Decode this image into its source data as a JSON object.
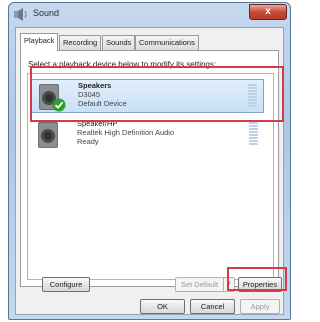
{
  "window": {
    "title": "Sound",
    "close_label": "x"
  },
  "tabs": [
    {
      "label": "Playback",
      "active": true
    },
    {
      "label": "Recording",
      "active": false
    },
    {
      "label": "Sounds",
      "active": false
    },
    {
      "label": "Communications",
      "active": false
    }
  ],
  "panel": {
    "instruction": "Select a playback device below to modify its settings:"
  },
  "devices": [
    {
      "name": "Speakers",
      "description": "D3045",
      "status": "Default Device",
      "selected": true,
      "default": true,
      "icon": "speaker-icon"
    },
    {
      "name": "Speaker/HP",
      "description": "Realtek High Definition Audio",
      "status": "Ready",
      "selected": false,
      "default": false,
      "icon": "speaker-icon"
    }
  ],
  "buttons": {
    "configure": "Configure",
    "set_default": "Set Default",
    "properties": "Properties",
    "ok": "OK",
    "cancel": "Cancel",
    "apply": "Apply"
  },
  "colors": {
    "highlight": "#d43a4a",
    "selection": "#c9e0f7",
    "default_check": "#2f9e2f"
  }
}
